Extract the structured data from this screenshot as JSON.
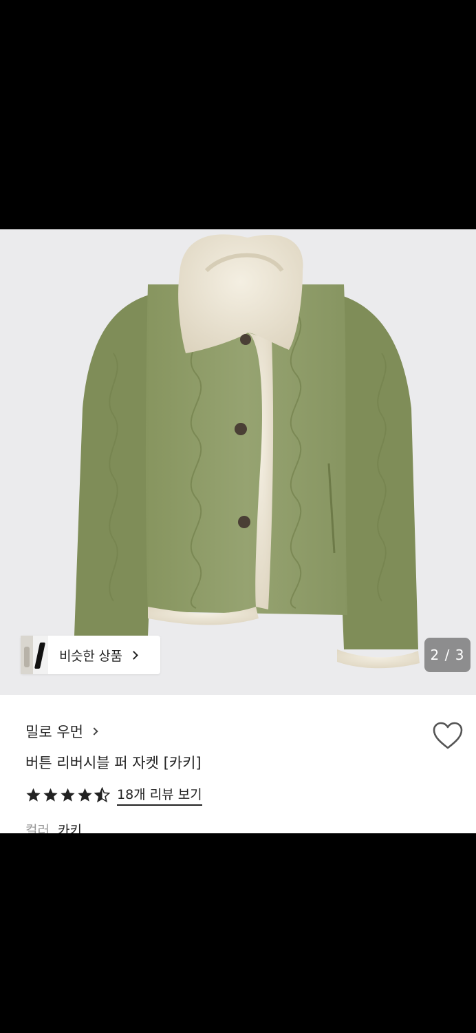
{
  "gallery": {
    "similar_button": "비슷한 상품",
    "page_counter": "2 / 3",
    "image_subject": "khaki-quilted-jacket-with-fleece-collar"
  },
  "product": {
    "brand": "밀로 우먼",
    "title": "버튼 리버시블 퍼 자켓 [카키]",
    "rating": 4.5,
    "review_link": "18개 리뷰 보기",
    "option_label": "컬러",
    "option_value": "카키"
  },
  "colors": {
    "jacket": "#8f9c6b",
    "fleece": "#ece6d6",
    "gallery_bg": "#ebebed"
  },
  "icons": {
    "favorite": "heart-outline-icon",
    "similar": "chevron-right-icon",
    "brand": "chevron-right-icon"
  }
}
